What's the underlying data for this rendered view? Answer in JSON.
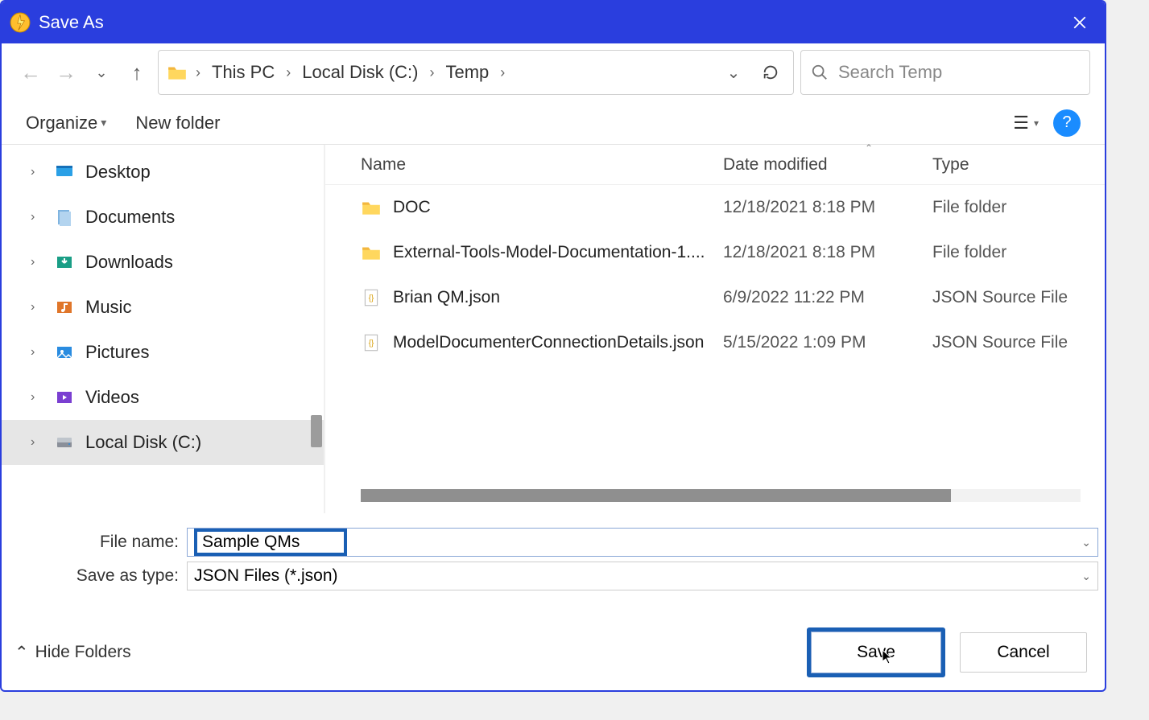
{
  "window": {
    "title": "Save As"
  },
  "breadcrumbs": {
    "b0": "This PC",
    "b1": "Local Disk (C:)",
    "b2": "Temp"
  },
  "search": {
    "placeholder": "Search Temp"
  },
  "toolbar": {
    "organize": "Organize",
    "newfolder": "New folder"
  },
  "sidebar": {
    "items": [
      {
        "label": "Desktop"
      },
      {
        "label": "Documents"
      },
      {
        "label": "Downloads"
      },
      {
        "label": "Music"
      },
      {
        "label": "Pictures"
      },
      {
        "label": "Videos"
      },
      {
        "label": "Local Disk (C:)"
      }
    ]
  },
  "columns": {
    "name": "Name",
    "date": "Date modified",
    "type": "Type"
  },
  "files": [
    {
      "name": "DOC",
      "date": "12/18/2021 8:18 PM",
      "type": "File folder",
      "kind": "folder"
    },
    {
      "name": "External-Tools-Model-Documentation-1....",
      "date": "12/18/2021 8:18 PM",
      "type": "File folder",
      "kind": "folder"
    },
    {
      "name": "Brian QM.json",
      "date": "6/9/2022 11:22 PM",
      "type": "JSON Source File",
      "kind": "json"
    },
    {
      "name": "ModelDocumenterConnectionDetails.json",
      "date": "5/15/2022 1:09 PM",
      "type": "JSON Source File",
      "kind": "json"
    }
  ],
  "form": {
    "filename_label": "File name:",
    "filename_value": "Sample QMs",
    "type_label": "Save as type:",
    "type_value": "JSON Files (*.json)"
  },
  "actions": {
    "hide": "Hide Folders",
    "save": "Save",
    "cancel": "Cancel"
  }
}
